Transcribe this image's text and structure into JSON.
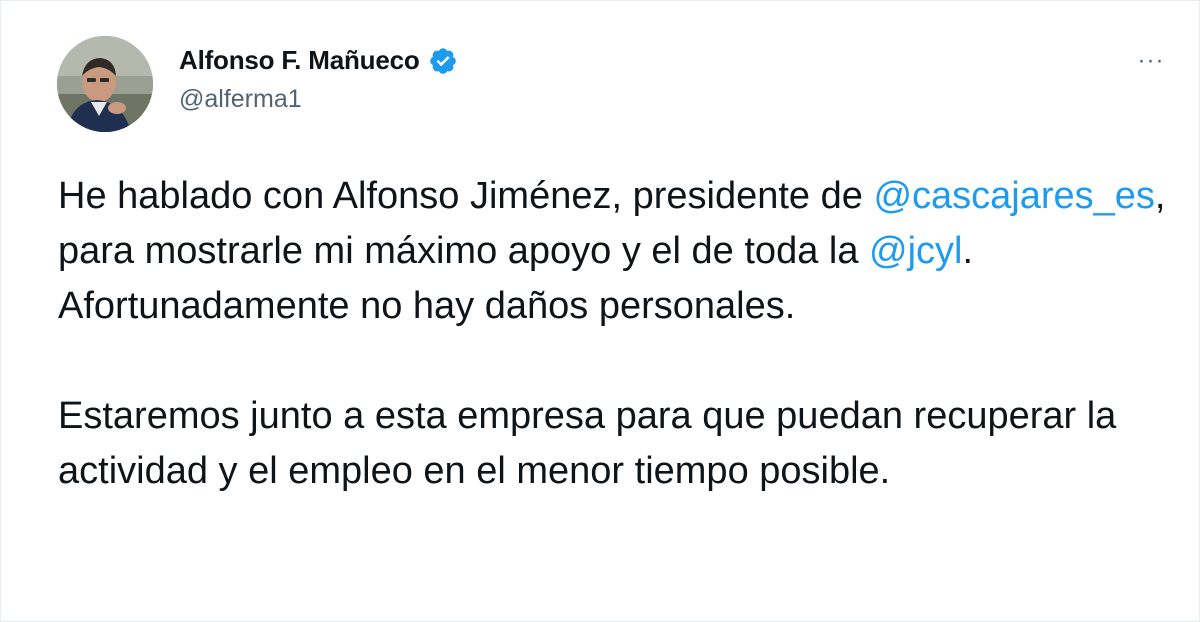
{
  "author": {
    "display_name": "Alfonso F. Mañueco",
    "handle": "@alferma1",
    "verified": true,
    "verified_icon": "verified-badge-icon",
    "avatar": "profile-photo"
  },
  "menu": {
    "more_label": "···",
    "more_icon": "more-horizontal-icon"
  },
  "tweet": {
    "p1_part1": "He hablado con Alfonso Jiménez, presidente de ",
    "mention1": "@cascajares_es",
    "p1_part2": ", para mostrarle mi máximo apoyo y el de toda la ",
    "mention2": "@jcyl",
    "p1_part3": ". Afortunadamente no hay daños personales.",
    "p2": "Estaremos junto a esta empresa para que puedan recuperar la actividad y el empleo en el menor tiempo posible."
  },
  "colors": {
    "link": "#1d9bf0",
    "text": "#0f1419",
    "secondary": "#536471",
    "border": "#e6ecf0"
  }
}
